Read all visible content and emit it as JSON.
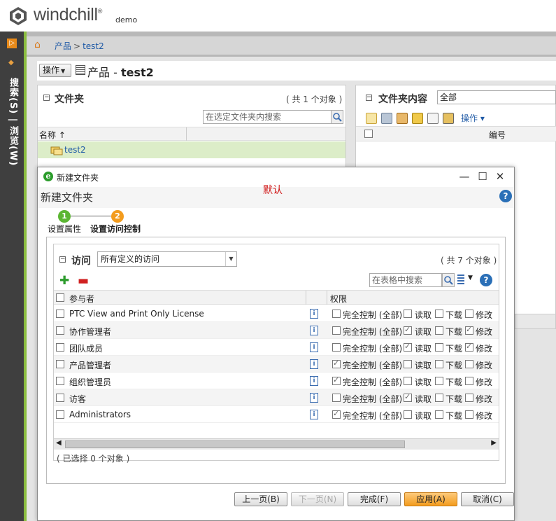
{
  "header": {
    "brand": "windchill",
    "tm": "®",
    "user": "demo"
  },
  "nav": {
    "vertical_label": "搜索(S) | 浏览(W)",
    "expand_glyph": "▷"
  },
  "breadcrumb": {
    "root": "产品",
    "separator": ">",
    "current": "test2"
  },
  "page": {
    "actions_label": "操作",
    "title_prefix": "产品 - ",
    "title_name": "test2"
  },
  "folders": {
    "title": "文件夹",
    "count": "( 共 1 个对象 )",
    "search_placeholder": "在选定文件夹内搜索",
    "column_name": "名称",
    "sort_glyph": "↑",
    "rows": [
      {
        "name": "test2"
      }
    ]
  },
  "contents": {
    "title": "文件夹内容",
    "filter": "全部",
    "actions_label": "操作",
    "column_number": "编号"
  },
  "dialog": {
    "window_title": "新建文件夹",
    "heading": "新建文件夹",
    "annotation": "默认",
    "steps": [
      {
        "num": "1",
        "label": "设置属性",
        "color": "#5bb632"
      },
      {
        "num": "2",
        "label": "设置访问控制",
        "color": "#f39c1e"
      }
    ],
    "access": {
      "title": "访问",
      "select_value": "所有定义的访问",
      "count": "( 共 7 个对象 )",
      "search_placeholder": "在表格中搜索",
      "col_participant": "参与者",
      "col_permissions": "权限",
      "perm_labels": [
        "完全控制 (全部)",
        "读取",
        "下载",
        "修改"
      ],
      "rows": [
        {
          "name": "PTC View and Print Only License",
          "perms": [
            false,
            false,
            false,
            false
          ]
        },
        {
          "name": "协作管理者",
          "perms": [
            false,
            true,
            false,
            true
          ]
        },
        {
          "name": "团队成员",
          "perms": [
            false,
            true,
            false,
            true
          ]
        },
        {
          "name": "产品管理者",
          "perms": [
            true,
            false,
            false,
            false
          ]
        },
        {
          "name": "组织管理员",
          "perms": [
            true,
            false,
            false,
            false
          ]
        },
        {
          "name": "访客",
          "perms": [
            false,
            true,
            false,
            false
          ]
        },
        {
          "name": "Administrators",
          "perms": [
            true,
            false,
            false,
            false
          ]
        }
      ],
      "status": "( 已选择 0 个对象 )"
    },
    "buttons": {
      "prev": "上一页(B)",
      "next": "下一页(N)",
      "finish": "完成(F)",
      "apply": "应用(A)",
      "cancel": "取消(C)"
    }
  },
  "colors": {
    "accent_green": "#8bbd3f",
    "link": "#1f5aa6",
    "apply": "#f39c1e",
    "annotation": "#d01010"
  }
}
